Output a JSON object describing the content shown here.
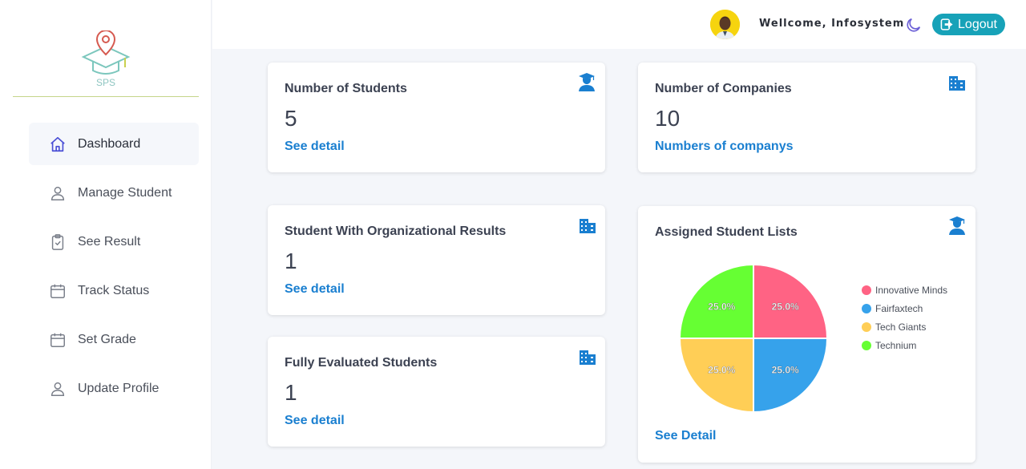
{
  "brand": {
    "logo_text": "SPS"
  },
  "sidebar": {
    "items": [
      {
        "label": "Dashboard",
        "icon": "home-icon"
      },
      {
        "label": "Manage Student",
        "icon": "user-icon"
      },
      {
        "label": "See Result",
        "icon": "clipboard-check-icon"
      },
      {
        "label": "Track Status",
        "icon": "calendar-icon"
      },
      {
        "label": "Set Grade",
        "icon": "calendar-icon"
      },
      {
        "label": "Update Profile",
        "icon": "user-icon"
      }
    ]
  },
  "header": {
    "welcome": "Wellcome, Infosystem",
    "logout_label": "Logout"
  },
  "cards": {
    "students": {
      "title": "Number of Students",
      "value": "5",
      "link": "See detail",
      "icon": "graduate-icon"
    },
    "companies": {
      "title": "Number of Companies",
      "value": "10",
      "link": "Numbers of companys",
      "icon": "building-icon"
    },
    "org_results": {
      "title": "Student With Organizational Results",
      "value": "1",
      "link": "See detail",
      "icon": "building-icon"
    },
    "evaluated": {
      "title": "Fully Evaluated Students",
      "value": "1",
      "link": "See detail",
      "icon": "building-icon"
    },
    "assigned": {
      "title": "Assigned Student Lists",
      "link": "See Detail",
      "icon": "graduate-icon"
    }
  },
  "colors": {
    "accent": "#1a7fd0",
    "logout_bg": "#17a2b8",
    "nav_active_icon": "#4b4fd6"
  },
  "chart_data": {
    "type": "pie",
    "labels": [
      "Innovative Minds",
      "Fairfaxtech",
      "Tech Giants",
      "Technium"
    ],
    "values": [
      25.0,
      25.0,
      25.0,
      25.0
    ],
    "value_labels": [
      "25.0%",
      "25.0%",
      "25.0%",
      "25.0%"
    ],
    "colors": [
      "#ff6384",
      "#36a2eb",
      "#ffce56",
      "#66ff33"
    ],
    "legend": "right"
  }
}
